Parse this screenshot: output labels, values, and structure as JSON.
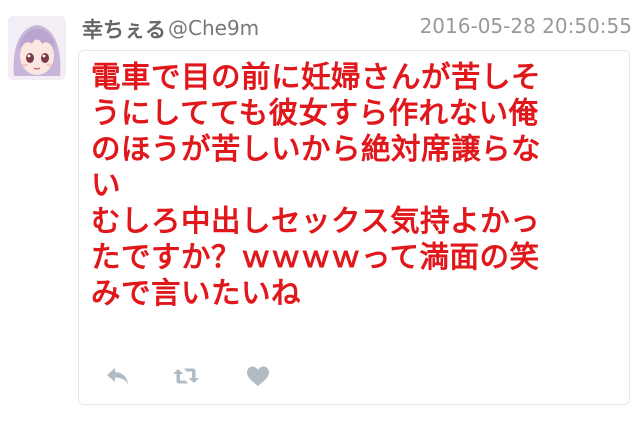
{
  "tweet": {
    "display_name": "幸ちぇる",
    "handle": "@Che9m",
    "timestamp": "2016-05-28 20:50:55",
    "text_lines": [
      "電車で目の前に妊婦さんが苦しそ",
      "うにしてても彼女すら作れない俺",
      "のほうが苦しいから絶対席譲らな",
      "い",
      "むしろ中出しセックス気持よかっ",
      "たですか？ｗｗｗｗって満面の笑",
      "みで言いたいね"
    ],
    "text_color": "#e0181c"
  },
  "actions": {
    "icons": [
      "reply-icon",
      "retweet-icon",
      "like-icon"
    ]
  },
  "colors": {
    "icon": "#b1bbc3",
    "border": "#e1e8ed"
  }
}
